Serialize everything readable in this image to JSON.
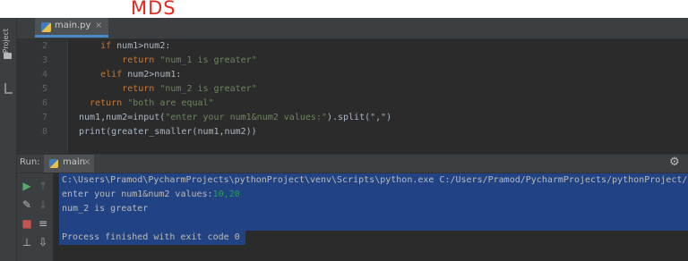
{
  "watermark": "MDS",
  "sidebar": {
    "project_label": "Project"
  },
  "editor": {
    "tab_label": "main.py",
    "tab_close": "×",
    "line_numbers": [
      "2",
      "3",
      "4",
      "5",
      "6",
      "7",
      "8"
    ],
    "code_lines": [
      {
        "indent": "    ",
        "kw": "if",
        "rest": " num1>num2:",
        "str": ""
      },
      {
        "indent": "        ",
        "kw": "return",
        "rest": " ",
        "str": "\"num_1 is greater\""
      },
      {
        "indent": "    ",
        "kw": "elif",
        "rest": " num2>num1:",
        "str": ""
      },
      {
        "indent": "        ",
        "kw": "return",
        "rest": " ",
        "str": "\"num_2 is greater\""
      },
      {
        "indent": "  ",
        "kw": "return",
        "rest": " ",
        "str": "\"both are equal\""
      },
      {
        "indent": "",
        "kw": "",
        "rest": "num1,num2=input(",
        "str": "\"enter your num1&num2 values:\"",
        "tail": ").split(\",\")"
      },
      {
        "indent": "",
        "kw": "",
        "rest": "print(greater_smaller(num1,num2))",
        "str": ""
      }
    ]
  },
  "run_panel": {
    "label": "Run:",
    "tab_label": "main",
    "tab_close": "×",
    "gear_icon": "gear-icon",
    "console_lines": {
      "command": "C:\\Users\\Pramod\\PycharmProjects\\pythonProject\\venv\\Scripts\\python.exe C:/Users/Pramod/PycharmProjects/pythonProject/",
      "prompt": "enter your num1&num2 values:",
      "input_value": "10,20",
      "result": "num_2 is greater",
      "exit": "Process finished with exit code 0"
    }
  }
}
